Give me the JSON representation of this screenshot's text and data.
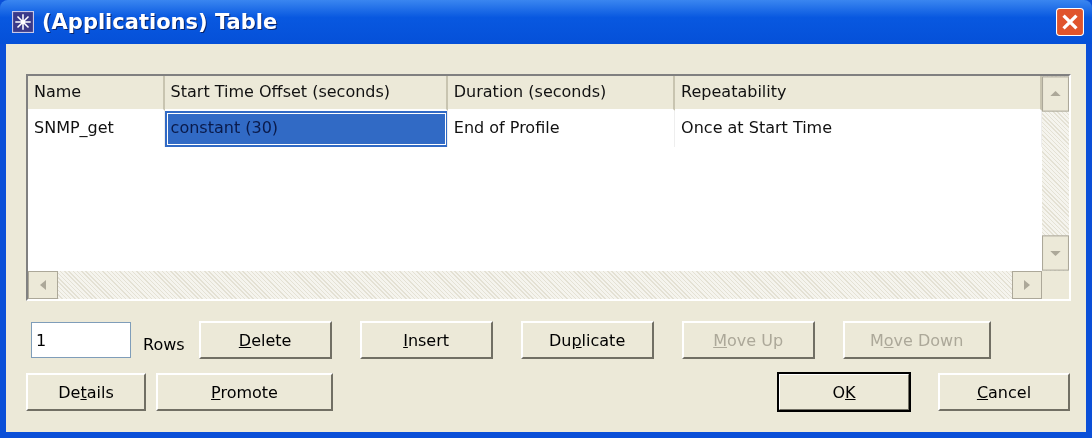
{
  "window": {
    "title": "(Applications) Table"
  },
  "table": {
    "columns": [
      "Name",
      "Start Time Offset (seconds)",
      "Duration (seconds)",
      "Repeatability"
    ],
    "rows": [
      {
        "cells": [
          {
            "text": "SNMP_get",
            "selected": false
          },
          {
            "text": "constant (30)",
            "selected": true
          },
          {
            "text": "End of Profile",
            "selected": false
          },
          {
            "text": "Once at Start Time",
            "selected": false
          }
        ]
      }
    ]
  },
  "rows_field": {
    "value": "1",
    "label": "Rows"
  },
  "top_buttons": [
    {
      "key": "D",
      "after": "elete",
      "disabled": false,
      "default": false
    },
    {
      "key": "I",
      "after": "nsert",
      "disabled": false,
      "default": false
    },
    {
      "before": "Du",
      "key": "p",
      "after": "licate",
      "disabled": false,
      "default": false
    },
    {
      "key": "M",
      "after": "ove Up",
      "disabled": true,
      "default": false
    },
    {
      "before": "M",
      "key": "o",
      "after": "ve Down",
      "disabled": true,
      "default": false
    }
  ],
  "left_buttons": [
    {
      "before": "De",
      "key": "t",
      "after": "ails",
      "disabled": false,
      "default": false
    },
    {
      "key": "P",
      "after": "romote",
      "disabled": false,
      "default": false
    }
  ],
  "right_buttons": [
    {
      "before": "O",
      "key": "K",
      "disabled": false,
      "default": true
    },
    {
      "key": "C",
      "after": "ancel",
      "disabled": false,
      "default": false
    }
  ]
}
